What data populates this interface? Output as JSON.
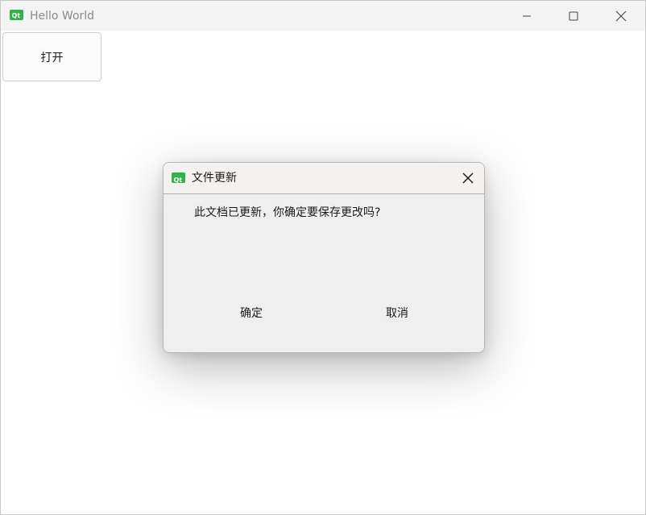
{
  "window": {
    "title": "Hello World"
  },
  "main": {
    "open_button_label": "打开"
  },
  "dialog": {
    "title": "文件更新",
    "message": "此文档已更新，你确定要保存更改吗?",
    "ok_label": "确定",
    "cancel_label": "取消"
  },
  "icons": {
    "app_logo": "qt-logo-icon",
    "minimize": "minimize-icon",
    "maximize": "maximize-icon",
    "close": "close-icon"
  },
  "colors": {
    "titlebar_bg": "#f3f3f3",
    "dialog_bg": "#efefef",
    "dialog_titlebar_bg": "#f4f1ef",
    "logo_green": "#2fb34a"
  }
}
